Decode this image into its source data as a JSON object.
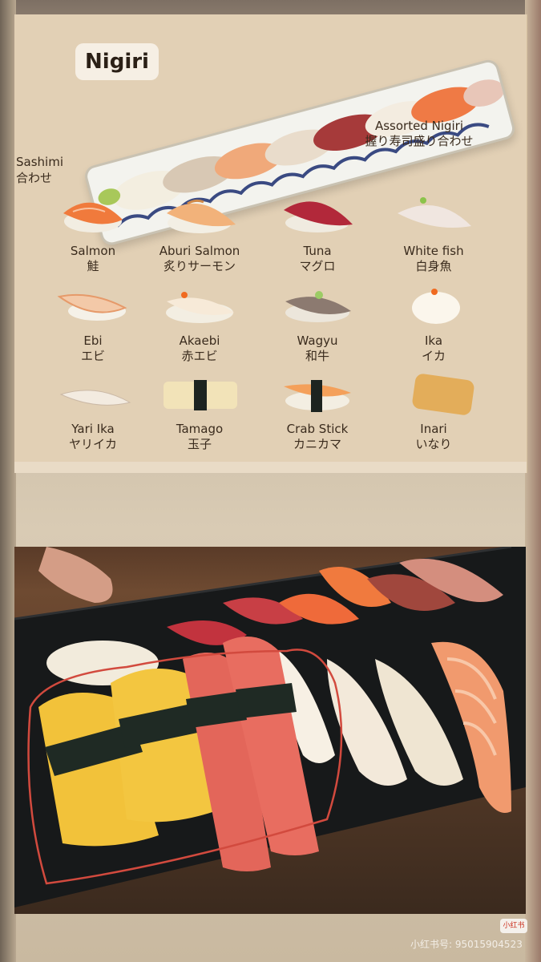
{
  "menu": {
    "title": "Nigiri",
    "left_cut_text": {
      "en": "Sashimi",
      "jp": "合わせ"
    },
    "platter": {
      "en": "Assorted Nigiri",
      "jp": "握り寿司盛り合わせ"
    },
    "items": [
      {
        "en": "Salmon",
        "jp": "鮭",
        "icon": "salmon-nigiri-icon"
      },
      {
        "en": "Aburi Salmon",
        "jp": "炙りサーモン",
        "icon": "aburi-salmon-nigiri-icon"
      },
      {
        "en": "Tuna",
        "jp": "マグロ",
        "icon": "tuna-nigiri-icon"
      },
      {
        "en": "White fish",
        "jp": "白身魚",
        "icon": "white-fish-nigiri-icon"
      },
      {
        "en": "Ebi",
        "jp": "エビ",
        "icon": "ebi-nigiri-icon"
      },
      {
        "en": "Akaebi",
        "jp": "赤エビ",
        "icon": "akaebi-nigiri-icon"
      },
      {
        "en": "Wagyu",
        "jp": "和牛",
        "icon": "wagyu-nigiri-icon"
      },
      {
        "en": "Ika",
        "jp": "イカ",
        "icon": "ika-nigiri-icon"
      },
      {
        "en": "Yari Ika",
        "jp": "ヤリイカ",
        "icon": "yari-ika-nigiri-icon"
      },
      {
        "en": "Tamago",
        "jp": "玉子",
        "icon": "tamago-nigiri-icon"
      },
      {
        "en": "Crab Stick",
        "jp": "カニカマ",
        "icon": "crab-stick-nigiri-icon"
      },
      {
        "en": "Inari",
        "jp": "いなり",
        "icon": "inari-icon"
      }
    ]
  },
  "photo": {
    "subject": "sushi-platter-photo",
    "highlight": "red-outline-around-tamago-and-crab-stick"
  },
  "footer": {
    "badge": "小红书",
    "watermark": "小红书号: 95015904523"
  }
}
